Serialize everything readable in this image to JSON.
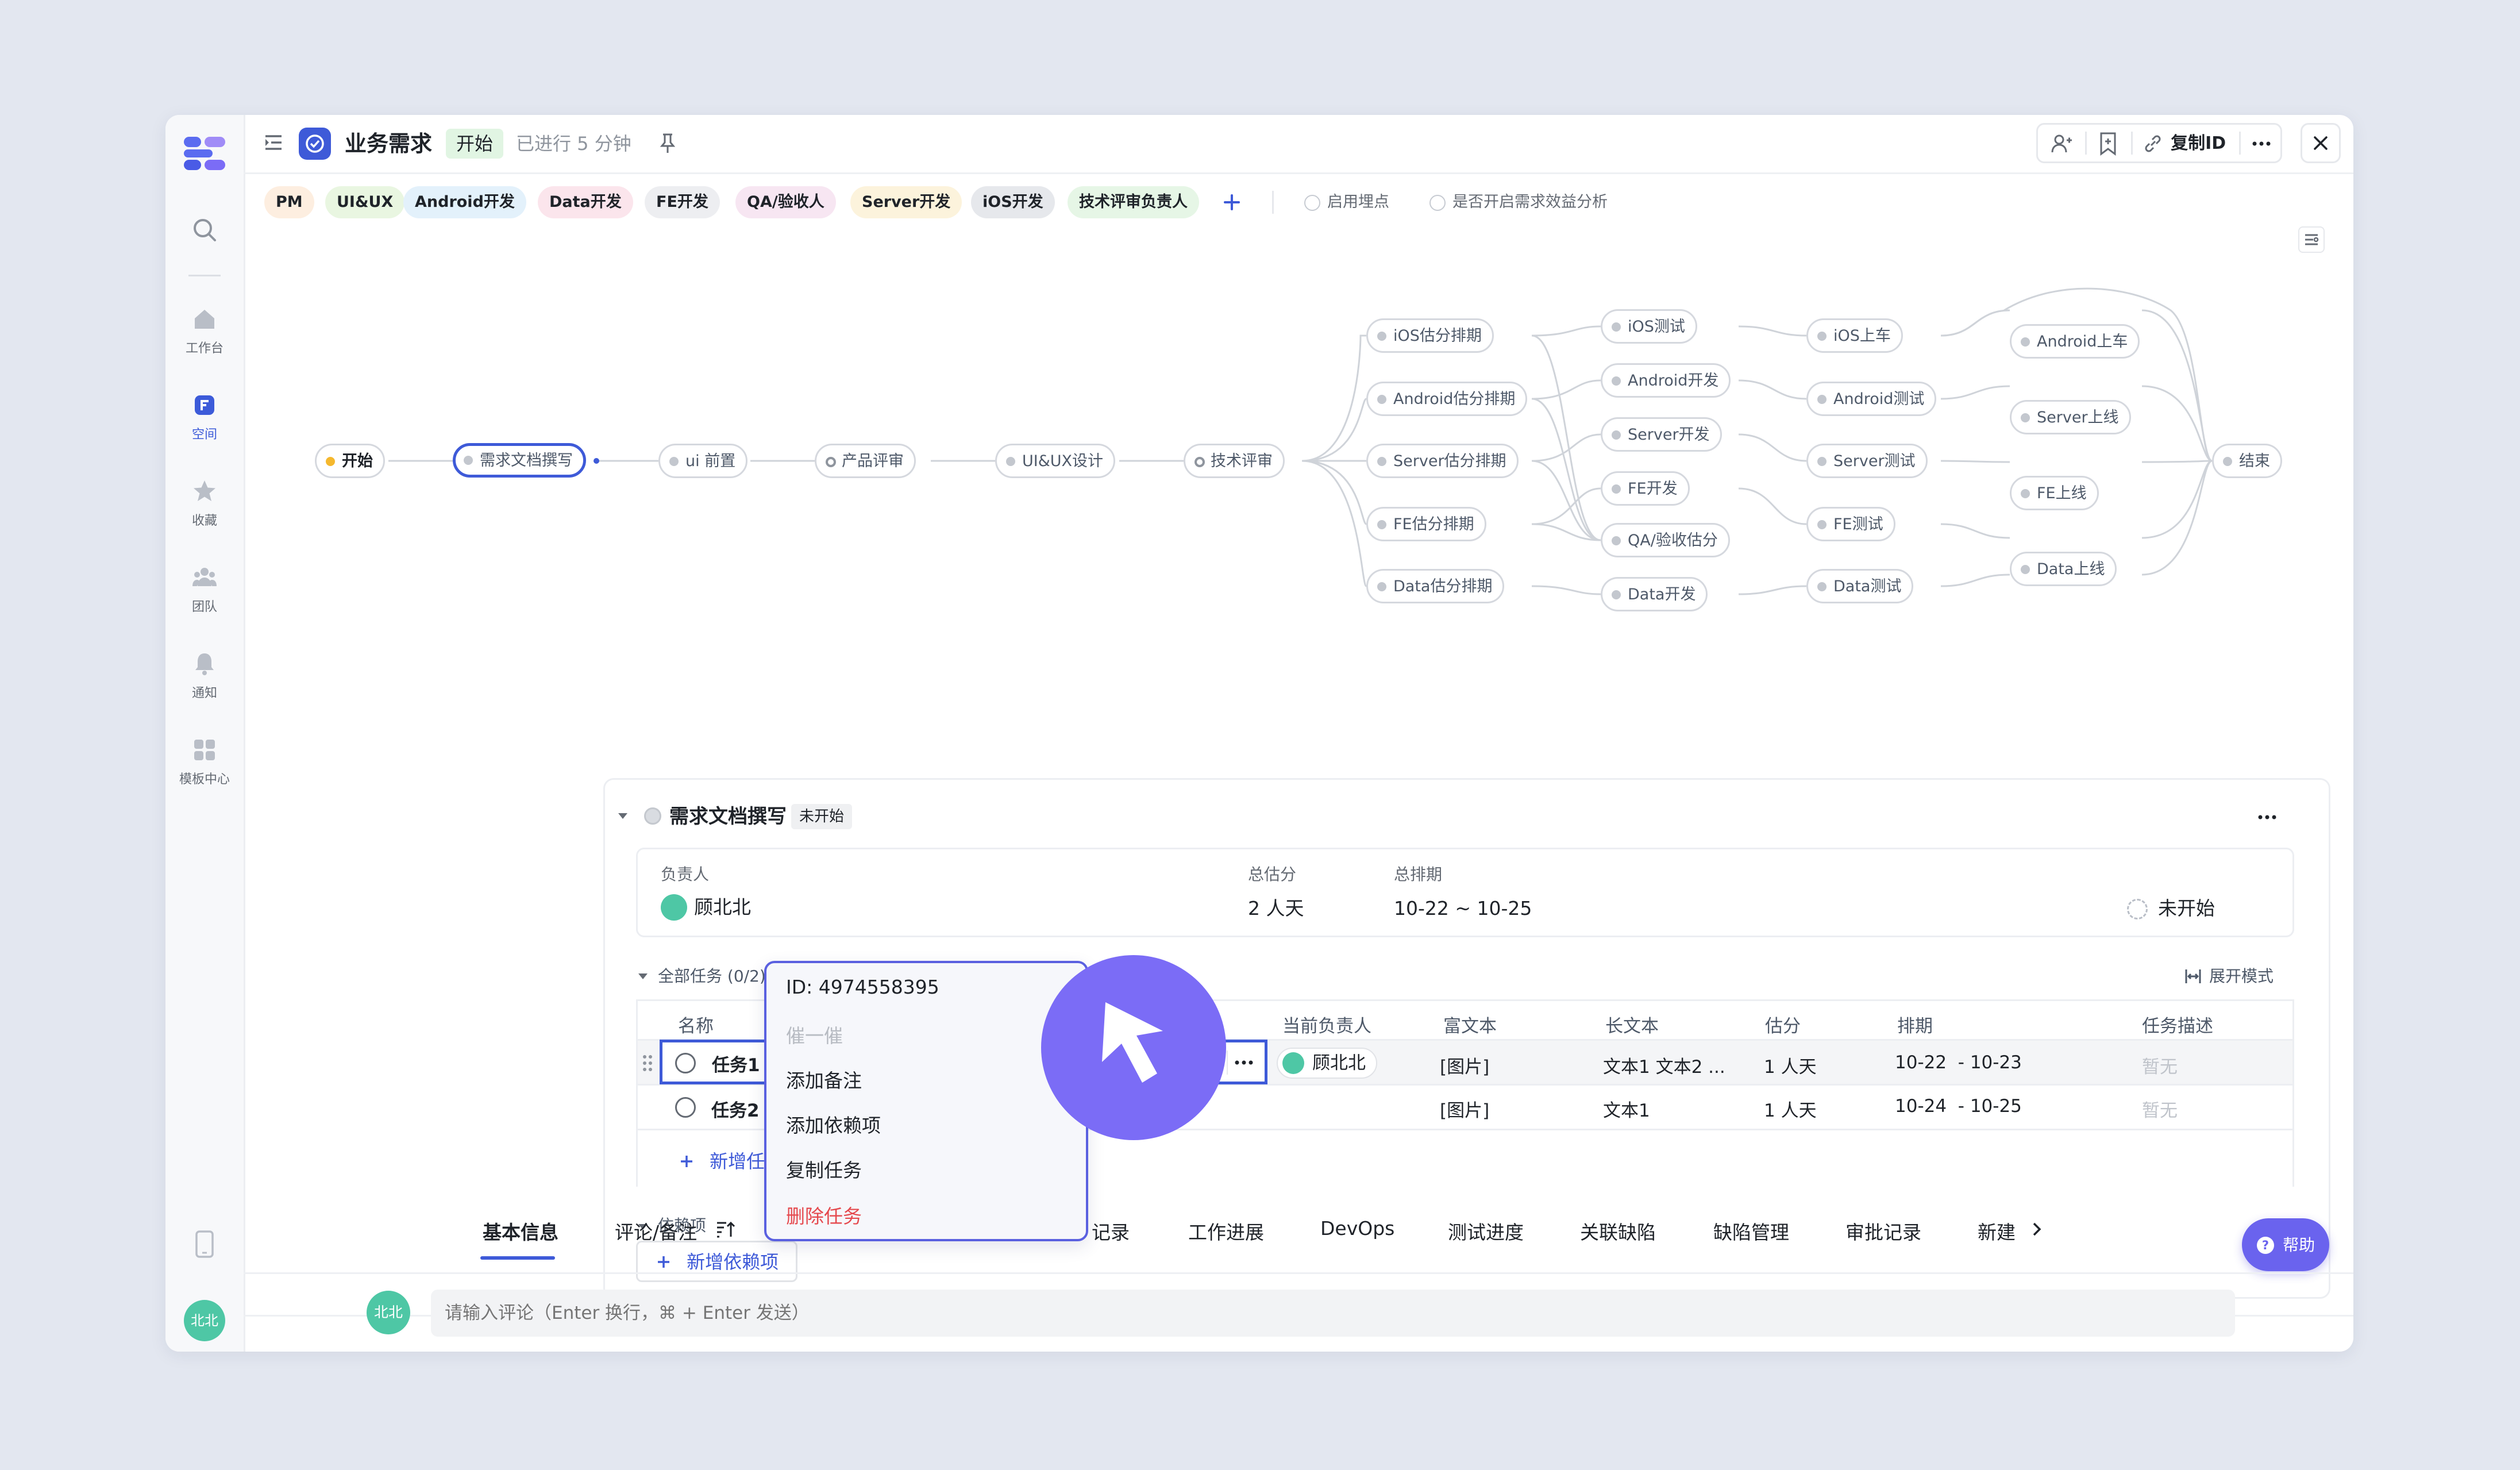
{
  "header": {
    "title": "业务需求",
    "status": "开始",
    "elapsed": "已进行 5 分钟",
    "copy_id": "复制ID"
  },
  "roles": [
    "PM",
    "UI&UX",
    "Android开发",
    "Data开发",
    "FE开发",
    "QA/验收人",
    "Server开发",
    "iOS开发",
    "技术评审负责人"
  ],
  "options": {
    "tracking": "启用埋点",
    "benefit": "是否开启需求效益分析"
  },
  "sidebar": {
    "items": [
      {
        "label": "工作台"
      },
      {
        "label": "空间"
      },
      {
        "label": "收藏"
      },
      {
        "label": "团队"
      },
      {
        "label": "通知"
      },
      {
        "label": "模板中心"
      }
    ],
    "avatar": "北北"
  },
  "flow": {
    "nodes": [
      "开始",
      "需求文档撰写",
      "ui 前置",
      "产品评审",
      "UI&UX设计",
      "技术评审",
      "iOS估分排期",
      "Android估分排期",
      "Server估分排期",
      "FE估分排期",
      "Data估分排期",
      "iOS测试",
      "Android开发",
      "Server开发",
      "FE开发",
      "QA/验收估分",
      "Data开发",
      "iOS上车",
      "Android测试",
      "Server测试",
      "FE测试",
      "Data测试",
      "Android上车",
      "Server上线",
      "FE上线",
      "Data上线",
      "结束"
    ]
  },
  "detail": {
    "title": "需求文档撰写",
    "status": "未开始",
    "owner_label": "负责人",
    "owner_name": "顾北北",
    "estimate_label": "总估分",
    "estimate_value": "2 人天",
    "schedule_label": "总排期",
    "schedule_value": "10-22 ~ 10-25",
    "state": "未开始",
    "tasks_label": "全部任务 (0/2)",
    "expand_mode": "展开模式",
    "columns": [
      "名称",
      "当前负责人",
      "富文本",
      "长文本",
      "估分",
      "排期",
      "任务描述"
    ],
    "rows": [
      {
        "name": "任务1",
        "owner": "顾北北",
        "rich": "[图片]",
        "long": "文本1 文本2 ...",
        "est": "1 人天",
        "sched": "10-22  - 10-23",
        "desc": "暂无"
      },
      {
        "name": "任务2",
        "owner": "",
        "rich": "[图片]",
        "long": "文本1",
        "est": "1 人天",
        "sched": "10-24  - 10-25",
        "desc": "暂无"
      }
    ],
    "add_task": "新增任务",
    "deps_label": "依赖项",
    "add_dep": "新增依赖项"
  },
  "menu": {
    "id": "ID: 4974558395",
    "items": [
      "催一催",
      "添加备注",
      "添加依赖项",
      "复制任务",
      "删除任务"
    ]
  },
  "tabs": [
    "基本信息",
    "评论/备注",
    "记录",
    "工作进展",
    "DevOps",
    "测试进度",
    "关联缺陷",
    "缺陷管理",
    "审批记录",
    "新建"
  ],
  "comment": {
    "avatar": "北北",
    "placeholder": "请输入评论（Enter 换行，⌘ + Enter 发送）"
  },
  "help": "帮助",
  "colors": {
    "accent": "#3e5ad8",
    "cursor": "#7b6cf6",
    "danger": "#e5484d"
  }
}
